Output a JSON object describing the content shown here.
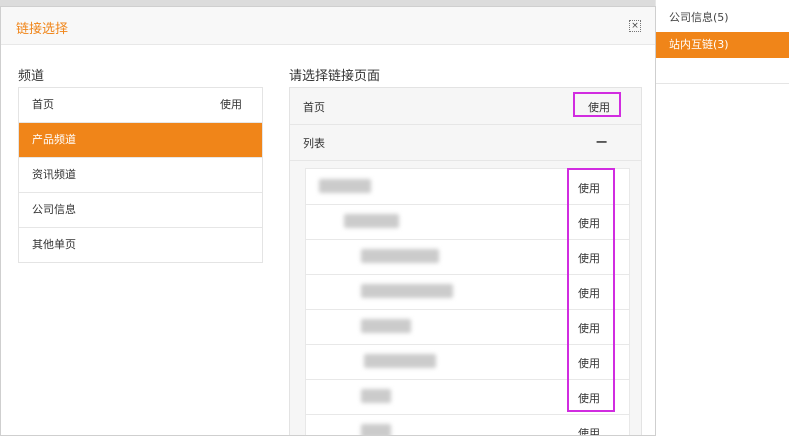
{
  "dialog": {
    "title": "链接选择",
    "close_glyph": "×"
  },
  "left": {
    "heading": "频道",
    "items": [
      {
        "label": "首页",
        "use": "使用"
      },
      {
        "label": "产品频道"
      },
      {
        "label": "资讯频道"
      },
      {
        "label": "公司信息"
      },
      {
        "label": "其他单页"
      }
    ]
  },
  "right": {
    "heading": "请选择链接页面",
    "home_label": "首页",
    "list_label": "列表",
    "collapse_glyph": "−",
    "use": "使用"
  },
  "background": {
    "items": [
      {
        "label": "公司信息(5)"
      },
      {
        "label": "站内互链(3)"
      }
    ]
  },
  "colors": {
    "accent": "#f08519",
    "highlight": "#d12ce0"
  }
}
